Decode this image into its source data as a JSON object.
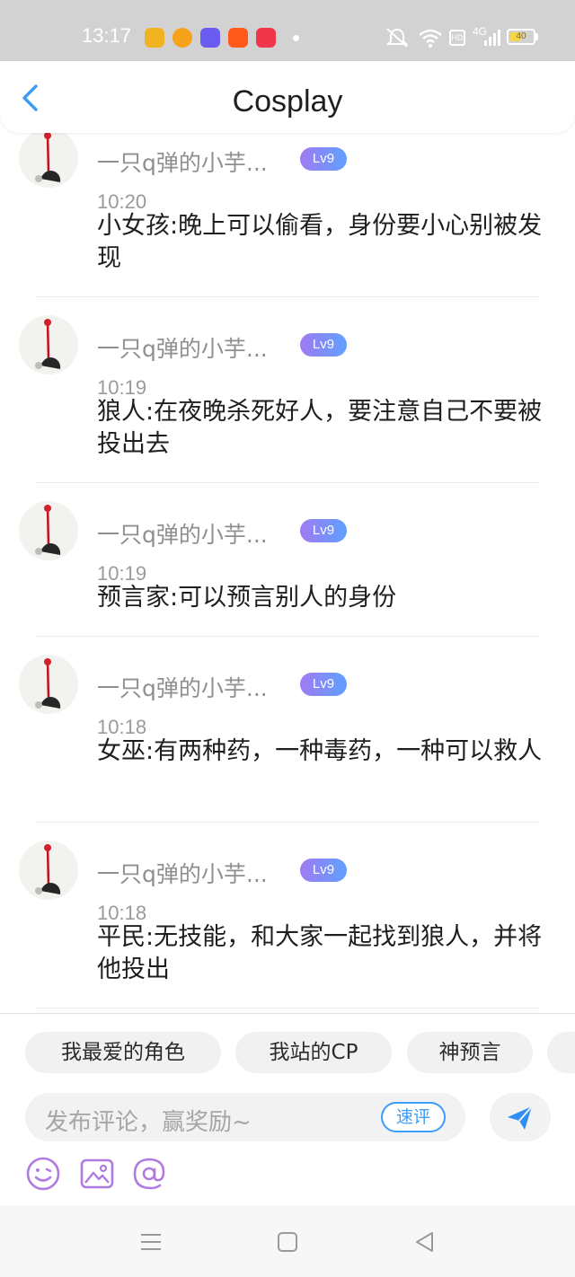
{
  "status_bar": {
    "time": "13:17",
    "network": "HD",
    "signal": "4G",
    "battery_level": "40",
    "app_icons": [
      {
        "name": "shield-app-icon",
        "color": "#f2b322"
      },
      {
        "name": "weibo-icon",
        "color": "#f6a21b"
      },
      {
        "name": "maps-app-icon",
        "color": "#6a5cf0"
      },
      {
        "name": "kuaishou-icon",
        "color": "#ff5a1a"
      },
      {
        "name": "recorder-app-icon",
        "color": "#f0364a"
      }
    ]
  },
  "header": {
    "title": "Cosplay"
  },
  "comments": [
    {
      "username": "一只q弹的小芋...",
      "level": "Lv9",
      "time": "10:20",
      "text": "小女孩:晚上可以偷看，身份要小心别被发现"
    },
    {
      "username": "一只q弹的小芋...",
      "level": "Lv9",
      "time": "10:19",
      "text": "狼人:在夜晚杀死好人，要注意自己不要被投出去"
    },
    {
      "username": "一只q弹的小芋...",
      "level": "Lv9",
      "time": "10:19",
      "text": "预言家:可以预言别人的身份"
    },
    {
      "username": "一只q弹的小芋...",
      "level": "Lv9",
      "time": "10:18",
      "text": "女巫:有两种药，一种毒药，一种可以救人"
    },
    {
      "username": "一只q弹的小芋...",
      "level": "Lv9",
      "time": "10:18",
      "text": "平民:无技能，和大家一起找到狼人，并将他投出"
    }
  ],
  "quick_tags": [
    "我最爱的角色",
    "我站的CP",
    "神预言",
    ""
  ],
  "composer": {
    "placeholder": "发布评论，赢奖励~",
    "quick_comment_label": "速评"
  },
  "colors": {
    "accent": "#3c9cf6",
    "level_badge_start": "#9f7bf2",
    "level_badge_end": "#5fa0ff",
    "toolbar_icon": "#b07be0"
  }
}
